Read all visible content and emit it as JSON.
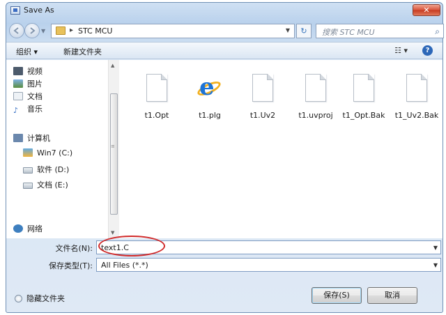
{
  "window": {
    "title": "Save As",
    "close_label": "✕"
  },
  "address": {
    "path": "STC MCU",
    "search_placeholder": "搜索 STC MCU"
  },
  "toolbar": {
    "organize": "组织 ▾",
    "new_folder": "新建文件夹",
    "view": "☷ ▾",
    "help": "?"
  },
  "nav": {
    "items": [
      {
        "label": "视频",
        "icon": "video-icon"
      },
      {
        "label": "图片",
        "icon": "picture-icon"
      },
      {
        "label": "文档",
        "icon": "document-icon"
      },
      {
        "label": "音乐",
        "icon": "music-icon"
      },
      {
        "label": "计算机",
        "icon": "computer-icon"
      },
      {
        "label": "Win7 (C:)",
        "icon": "drive-icon"
      },
      {
        "label": "软件 (D:)",
        "icon": "drive-icon"
      },
      {
        "label": "文档 (E:)",
        "icon": "drive-icon"
      },
      {
        "label": "网络",
        "icon": "network-icon"
      }
    ]
  },
  "files": [
    {
      "name": "t1.Opt",
      "icon": "file-icon"
    },
    {
      "name": "t1.plg",
      "icon": "ie-file-icon"
    },
    {
      "name": "t1.Uv2",
      "icon": "file-icon"
    },
    {
      "name": "t1.uvproj",
      "icon": "file-icon"
    },
    {
      "name": "t1_Opt.Bak",
      "icon": "file-icon"
    },
    {
      "name": "t1_Uv2.Bak",
      "icon": "file-icon"
    }
  ],
  "form": {
    "filename_label": "文件名(N):",
    "filename_value": "text1.C",
    "filetype_label": "保存类型(T):",
    "filetype_value": "All Files (*.*)"
  },
  "footer": {
    "hide_folders": "隐藏文件夹",
    "save": "保存(S)",
    "cancel": "取消"
  }
}
